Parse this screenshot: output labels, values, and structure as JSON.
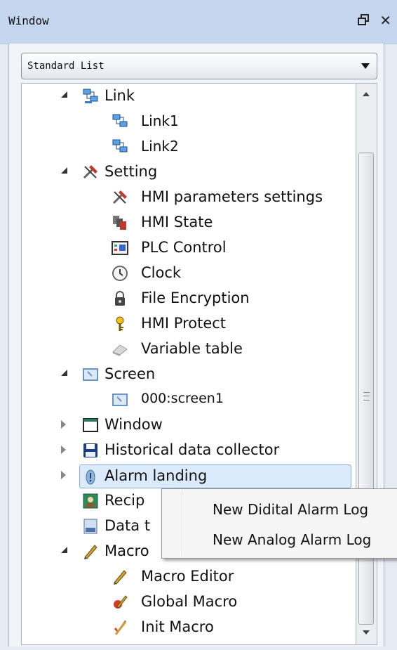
{
  "window": {
    "title": "Window",
    "pin_glyph": "ꟸ",
    "close_glyph": "✕"
  },
  "dropdown": {
    "selected": "Standard List"
  },
  "tree": {
    "link": {
      "label": "Link",
      "children": [
        "Link1",
        "Link2"
      ]
    },
    "setting": {
      "label": "Setting",
      "children": [
        "HMI parameters settings",
        "HMI State",
        "PLC Control",
        "Clock",
        "File Encryption",
        "HMI Protect",
        "Variable table"
      ]
    },
    "screen": {
      "label": "Screen",
      "children": [
        "000:screen1"
      ]
    },
    "window": {
      "label": "Window"
    },
    "historical": {
      "label": "Historical data collector"
    },
    "alarm": {
      "label": "Alarm landing"
    },
    "recipe": {
      "label": "Recip"
    },
    "data": {
      "label": "Data t"
    },
    "macro": {
      "label": "Macro",
      "children": [
        "Macro Editor",
        "Global Macro",
        "Init Macro"
      ]
    }
  },
  "context_menu": {
    "items": [
      "New Didital Alarm Log",
      "New Analog Alarm Log"
    ]
  },
  "colors": {
    "titlebar": "#c6d6ee",
    "selection": "#dcebfc",
    "selection_border": "#84acdd"
  }
}
